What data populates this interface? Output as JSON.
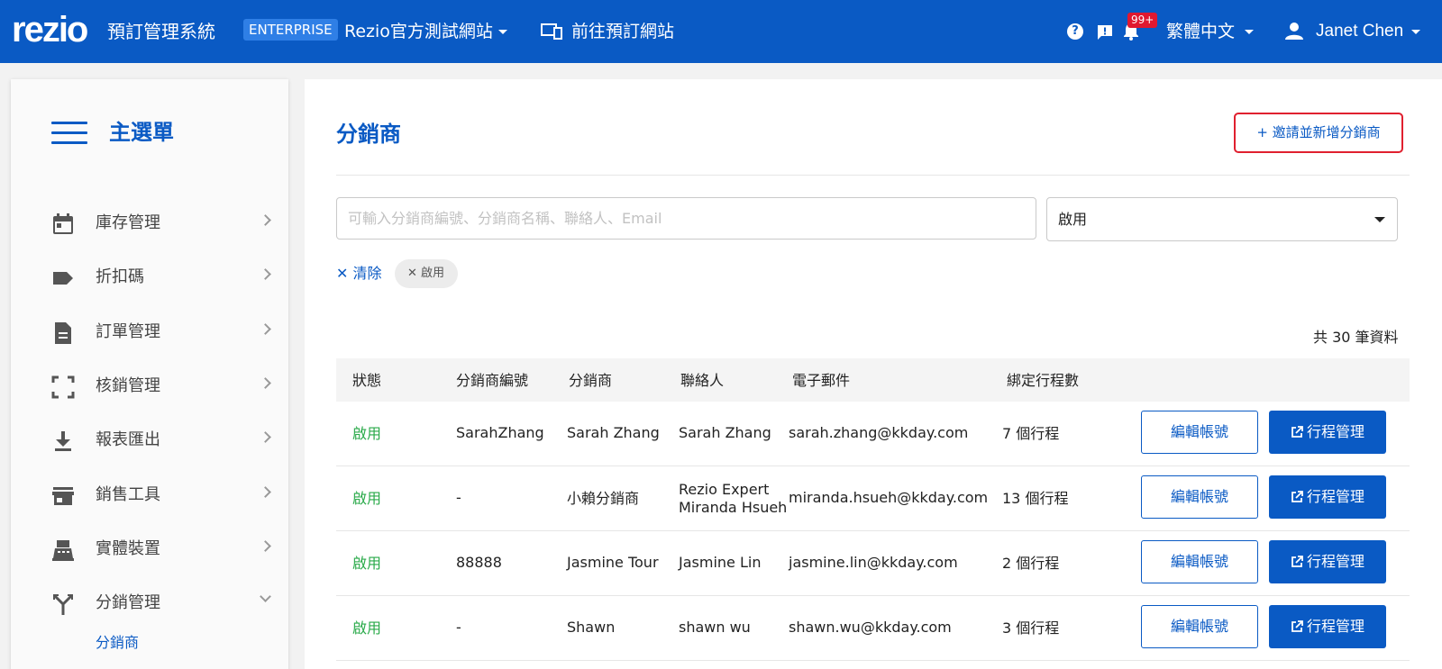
{
  "header": {
    "logo": "rezio",
    "app_name": "預訂管理系統",
    "plan_badge": "ENTERPRISE",
    "site_name": "Rezio官方測試網站",
    "goto_site": "前往預訂網站",
    "notification_count": "99+",
    "language": "繁體中文",
    "user_name": "Janet Chen"
  },
  "sidebar": {
    "title": "主選單",
    "items": [
      {
        "label": "庫存管理",
        "icon": "calendar-icon"
      },
      {
        "label": "折扣碼",
        "icon": "tag-icon"
      },
      {
        "label": "訂單管理",
        "icon": "document-icon"
      },
      {
        "label": "核銷管理",
        "icon": "scan-icon"
      },
      {
        "label": "報表匯出",
        "icon": "download-icon"
      },
      {
        "label": "銷售工具",
        "icon": "store-icon"
      },
      {
        "label": "實體裝置",
        "icon": "pos-icon"
      },
      {
        "label": "分銷管理",
        "icon": "distribution-icon"
      }
    ],
    "sub_item": "分銷商"
  },
  "main": {
    "title": "分銷商",
    "add_button": "+ 邀請並新增分銷商",
    "search_placeholder": "可輸入分銷商編號、分銷商名稱、聯絡人、Email",
    "status_filter": "啟用",
    "clear_label": "清除",
    "chip_label": "啟用",
    "total": "共 30 筆資料",
    "columns": [
      "狀態",
      "分銷商編號",
      "分銷商",
      "聯絡人",
      "電子郵件",
      "綁定行程數"
    ],
    "edit_label": "編輯帳號",
    "trip_label": "行程管理",
    "rows": [
      {
        "status": "啟用",
        "code": "SarahZhang",
        "name": "Sarah Zhang",
        "contact": "Sarah Zhang",
        "contact2": "",
        "email": "sarah.zhang@kkday.com",
        "trips": "7 個行程"
      },
      {
        "status": "啟用",
        "code": "-",
        "name": "小賴分銷商",
        "contact": "Rezio Expert",
        "contact2": "Miranda Hsueh",
        "email": "miranda.hsueh@kkday.com",
        "trips": "13 個行程"
      },
      {
        "status": "啟用",
        "code": "88888",
        "name": "Jasmine Tour",
        "contact": "Jasmine Lin",
        "contact2": "",
        "email": "jasmine.lin@kkday.com",
        "trips": "2 個行程"
      },
      {
        "status": "啟用",
        "code": "-",
        "name": "Shawn",
        "contact": "shawn wu",
        "contact2": "",
        "email": "shawn.wu@kkday.com",
        "trips": "3 個行程"
      }
    ]
  },
  "colors": {
    "primary": "#0a5ac4",
    "active_status": "#2aaa4a",
    "highlight": "#e0202f",
    "badge": "#e01830"
  }
}
